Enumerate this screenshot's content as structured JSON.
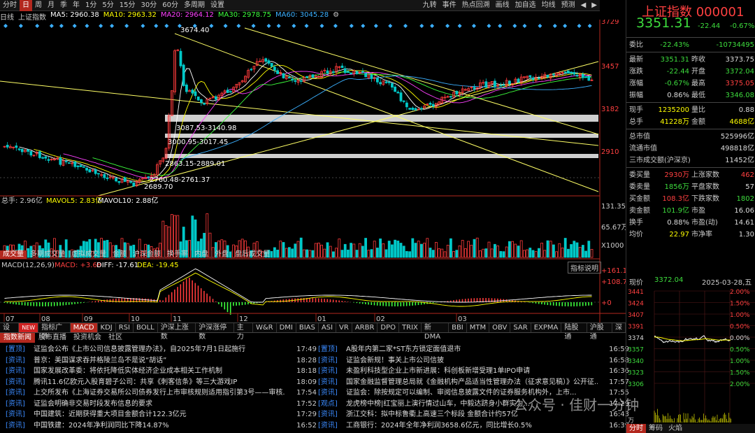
{
  "toolbar": {
    "items": [
      "分时",
      "日",
      "周",
      "月",
      "季",
      "年",
      "1分",
      "5分",
      "15分",
      "30分",
      "60分",
      "多周期",
      "设置"
    ],
    "active_index": 1,
    "right_items": [
      "九转",
      "事件",
      "热点回溯",
      "画线",
      "加自选",
      "均线",
      "预测"
    ]
  },
  "ma": {
    "period": "日线",
    "name": "上证指数",
    "ma5": "MA5: 2960.38",
    "ma10": "MA10: 2963.32",
    "ma20": "MA20: 2964.12",
    "ma30": "MA30: 2978.75",
    "ma60": "MA60: 3045.28"
  },
  "colors": {
    "up": "#ff3b3b",
    "down": "#00c8c8",
    "ma5": "#ffffff",
    "ma10": "#ffff00",
    "ma20": "#ff40ff",
    "ma30": "#3dff3d",
    "ma60": "#3bb0ff"
  },
  "price_axis": [
    "3729",
    "3457",
    "3182",
    "2910"
  ],
  "price_labels": {
    "high": "3674.40",
    "zone1": "3087.53-3140.98",
    "zone2": "3000.95-3017.45",
    "zone3": "2863.15-2889.01",
    "zone4": "2760.48-2761.37",
    "low": "2689.70"
  },
  "volume": {
    "label": "总手: 2.96亿",
    "mavol5": "MAVOL5: 2.83亿",
    "mavol10": "MAVOL10: 2.88亿",
    "axis": [
      "131.35万",
      "65.67万",
      "X1000"
    ]
  },
  "sub_tabs": [
    "成交量",
    "多期成交量",
    "虚拟成交量",
    "金额",
    "沪深金额",
    "换手率",
    "内盘",
    "外盘",
    "盘后成交量"
  ],
  "macd": {
    "params": "MACD(12,26,9)",
    "macd": "MACD: +3.68",
    "diff": "DIFF: -17.61",
    "dea": "DEA: -19.45",
    "explain": "指标说明",
    "axis": [
      "+161.1",
      "+108.7",
      "+0"
    ]
  },
  "x_axis": [
    "07",
    "08",
    "09",
    "10",
    "11",
    "12",
    "01",
    "02",
    "03"
  ],
  "indicator_tabs": [
    "设置",
    "NEW",
    "指标广场",
    "MACD",
    "KDJ",
    "RSI",
    "BOLL",
    "沪深上涨数",
    "沪深涨停数",
    "主力",
    "W&R",
    "DMI",
    "BIAS",
    "ASI",
    "VR",
    "ARBR",
    "DPO",
    "TRIX",
    "新DMA",
    "BBI",
    "MTM",
    "OBV",
    "SAR",
    "EXPMA",
    "陆股通",
    "沪股通",
    "深"
  ],
  "news_tabs": [
    "指数新闻",
    "股市直播",
    "投资机会",
    "社区"
  ],
  "news_left": [
    {
      "tag": "[置顶]",
      "title": "证监会公布《上市公司信息披露管理办法》，自2025年7月1日起施行",
      "time": "17:49"
    },
    {
      "tag": "[资讯]",
      "title": "普京：美国谋求吞并格陵兰岛不是说“胡话”",
      "time": "18:28"
    },
    {
      "tag": "[资讯]",
      "title": "国家发展改革委：将依托降低实体经济企业成本相关工作机制",
      "time": "18:18"
    },
    {
      "tag": "[资讯]",
      "title": "腾讯11.6亿欧元入股育碧子公司：共享《刺客信条》等三大游戏IP",
      "time": "18:09"
    },
    {
      "tag": "[资讯]",
      "title": "上交所发布《上海证券交易所公司债券发行上市审核规则适用指引第3号——审核...",
      "time": "17:54"
    },
    {
      "tag": "[资讯]",
      "title": "证监会明确非交易时段发布信息的要求",
      "time": "17:52"
    },
    {
      "tag": "[资讯]",
      "title": "中国建筑：近期获得重大项目金额合计122.3亿元",
      "time": "17:29"
    },
    {
      "tag": "[资讯]",
      "title": "中国铁建：2024年净利润同比下降14.87%",
      "time": "16:52"
    }
  ],
  "news_right": [
    {
      "tag": "[置顶]",
      "title": "A股年内第二家*ST东方锁定面值退市",
      "time": "16:59"
    },
    {
      "tag": "[资讯]",
      "title": "证监会新规！事关上市公司信披",
      "time": "16:58"
    },
    {
      "tag": "[资讯]",
      "title": "未盈利科技型企业上市新进展：科创板新增受理1单IPO申请",
      "time": "16:36"
    },
    {
      "tag": "[资讯]",
      "title": "国家金融监督管理总局就《金融机构产品适当性管理办法（征求意见稿）》公开征...",
      "time": "17:57"
    },
    {
      "tag": "[资讯]",
      "title": "证监会：除按规定可以编制、审阅信息披露文件的证券服务机构外，上市...",
      "time": "17:55"
    },
    {
      "tag": "[观点]",
      "title": "龙虎榜中榜|红宝丽上演行情过山车，中毅达跻身小群实力...",
      "time": "17:29"
    },
    {
      "tag": "[资讯]",
      "title": "浙江交科：拟中标鲁衢上高速三个标段 金额合计约57亿",
      "time": "16:43"
    },
    {
      "tag": "[资讯]",
      "title": "工商银行：2024年全年净利润3658.6亿元，同比增长0.5%",
      "time": "16:39"
    }
  ],
  "quote": {
    "title": "上证指数  000001",
    "price": "3351.31",
    "change": "-22.44",
    "pct": "-0.67%",
    "rows1": [
      {
        "k1": "委比",
        "v1": "-22.43%",
        "k2": "",
        "v2": "-10734495",
        "c1": "#3ddc3d",
        "c2": "#3ddc3d"
      }
    ],
    "rows2": [
      {
        "k1": "最新",
        "v1": "3351.31",
        "k2": "昨收",
        "v2": "3373.75",
        "c1": "#3ddc3d",
        "c2": "#ddd"
      },
      {
        "k1": "涨跌",
        "v1": "-22.44",
        "k2": "开盘",
        "v2": "3372.04",
        "c1": "#3ddc3d",
        "c2": "#3ddc3d"
      },
      {
        "k1": "涨幅",
        "v1": "-0.67%",
        "k2": "最高",
        "v2": "3375.05",
        "c1": "#3ddc3d",
        "c2": "#ff4040"
      },
      {
        "k1": "振幅",
        "v1": "0.86%",
        "k2": "最低",
        "v2": "3346.08",
        "c1": "#ddd",
        "c2": "#3ddc3d"
      }
    ],
    "rows3": [
      {
        "k1": "现手",
        "v1": "1235200",
        "k2": "量比",
        "v2": "0.88",
        "c1": "#ffff00",
        "c2": "#ddd"
      },
      {
        "k1": "总手",
        "v1": "41228万",
        "k2": "金额",
        "v2": "4688亿",
        "c1": "#ffff00",
        "c2": "#ffff00"
      }
    ],
    "rows4": [
      {
        "k1": "总市值",
        "v2": "525996亿",
        "c2": "#ddd"
      },
      {
        "k1": "流通市值",
        "v2": "498818亿",
        "c2": "#ddd"
      },
      {
        "k1": "三市成交额(沪深京)",
        "v2": "11452亿",
        "c2": "#ddd"
      }
    ],
    "rows5": [
      {
        "k1": "委买量",
        "v1": "2930万",
        "k2": "上涨家数",
        "v2": "462",
        "c1": "#ff4040",
        "c2": "#ff4040"
      },
      {
        "k1": "委卖量",
        "v1": "1856万",
        "k2": "平盘家数",
        "v2": "57",
        "c1": "#3ddc3d",
        "c2": "#ddd"
      },
      {
        "k1": "买金额",
        "v1": "108.3亿",
        "k2": "下跌家数",
        "v2": "1802",
        "c1": "#ff4040",
        "c2": "#3ddc3d"
      },
      {
        "k1": "卖金额",
        "v1": "101.9亿",
        "k2": "市盈",
        "v2": "16.06",
        "c1": "#3ddc3d",
        "c2": "#ddd"
      },
      {
        "k1": "换手",
        "v1": "0.88%",
        "k2": "市盈(动)",
        "v2": "14.61",
        "c1": "#ddd",
        "c2": "#ddd"
      },
      {
        "k1": "均价",
        "v1": "22.97",
        "k2": "市净率",
        "v2": "1.30",
        "c1": "#ffff00",
        "c2": "#ddd"
      }
    ],
    "now_label": "现价",
    "now_price": "3372.04",
    "date": "2025-03-28,五"
  },
  "mini_chart": {
    "left_axis": [
      "3441",
      "3424",
      "3407",
      "3391",
      "3374",
      "3357",
      "3340",
      "3323",
      "3306"
    ],
    "right_axis": [
      "2.00%",
      "1.50%",
      "1.00%",
      "0.50%",
      "0.00%",
      "0.50%",
      "1.00%",
      "1.50%",
      "2.00%"
    ],
    "bottom": "万",
    "tabs": [
      "分时",
      "筹码",
      "火焰"
    ]
  },
  "watermark": "公众号 · 佳财一分钟"
}
